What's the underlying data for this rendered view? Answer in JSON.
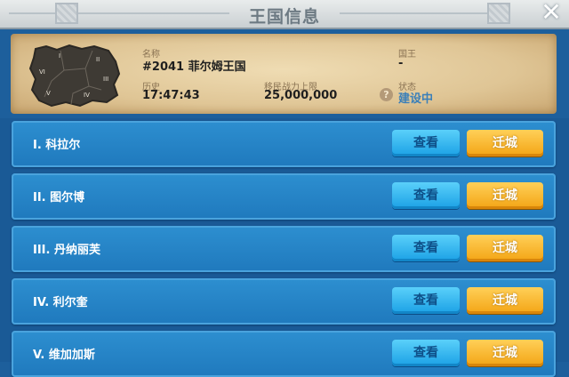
{
  "header": {
    "title": "王国信息",
    "close": "✕"
  },
  "kingdom": {
    "name_label": "名称",
    "name_value": "#2041 菲尔姆王国",
    "king_label": "国王",
    "king_value": "-",
    "history_label": "历史",
    "history_value": "17:47:43",
    "power_label": "移民战力上限",
    "power_value": "25,000,000",
    "status_label": "状态",
    "status_value": "建设中",
    "help_icon": "?",
    "map_labels": [
      "I",
      "II",
      "III",
      "IV",
      "V",
      "VI"
    ]
  },
  "regions": [
    {
      "name": "I. 科拉尔",
      "view": "查看",
      "move": "迁城"
    },
    {
      "name": "II. 图尔博",
      "view": "查看",
      "move": "迁城"
    },
    {
      "name": "III. 丹纳丽芙",
      "view": "查看",
      "move": "迁城"
    },
    {
      "name": "IV. 利尔奎",
      "view": "查看",
      "move": "迁城"
    },
    {
      "name": "V. 维加加斯",
      "view": "查看",
      "move": "迁城"
    }
  ]
}
